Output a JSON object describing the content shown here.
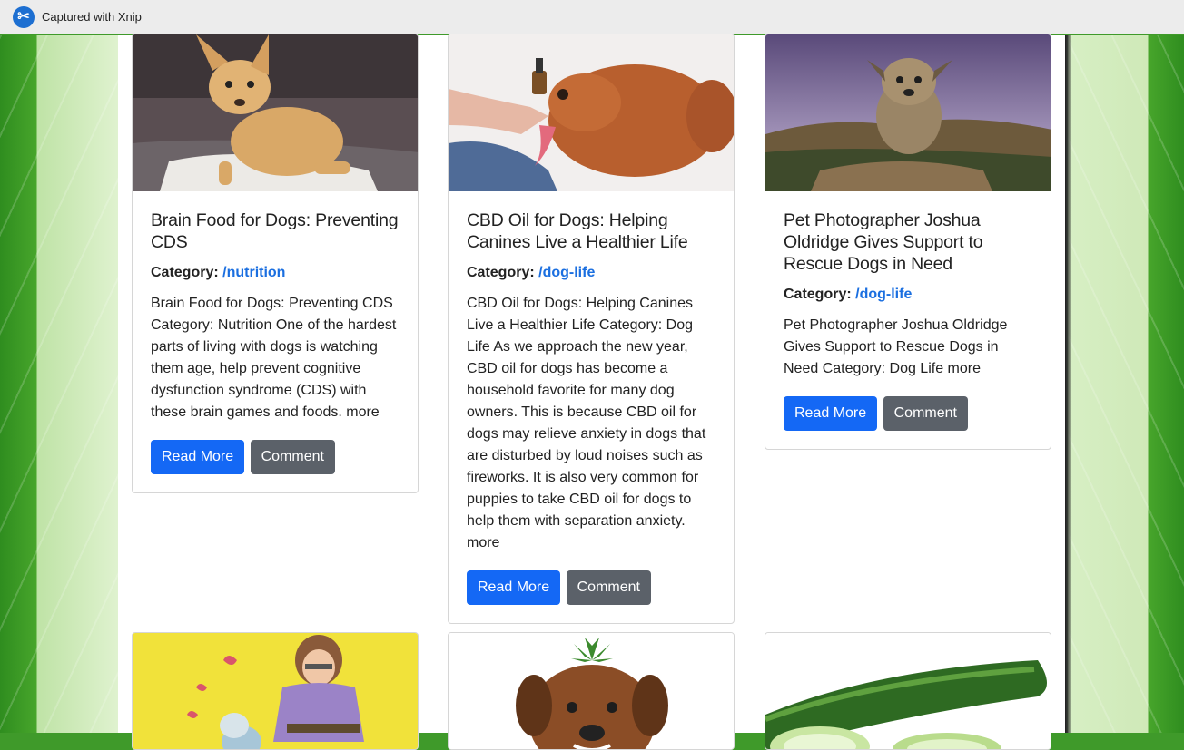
{
  "app": {
    "title": "Captured with Xnip"
  },
  "cards": [
    {
      "title": "Brain Food for Dogs: Preventing CDS",
      "category_label": "Category:",
      "category_link": "/nutrition",
      "excerpt": "Brain Food for Dogs: Preventing CDS Category: Nutrition One of the hardest parts of living with dogs is watching them age, help prevent cognitive dysfunction syndrome (CDS) with these brain games and foods.  more",
      "read_more": "Read More",
      "comment": "Comment",
      "image": "chihuahua-photo"
    },
    {
      "title": "CBD Oil for Dogs: Helping Canines Live a Healthier Life",
      "category_label": "Category:",
      "category_link": "/dog-life",
      "excerpt": "CBD Oil for Dogs: Helping Canines Live a Healthier Life Category: Dog Life As we approach the new year, CBD oil for dogs has become a household favorite for many dog owners. This is because CBD oil for dogs may relieve anxiety in dogs that are disturbed by loud noises such as fireworks. It is also very common for puppies to take CBD oil for dogs to help them with separation anxiety. more",
      "read_more": "Read More",
      "comment": "Comment",
      "image": "poodle-cbd-dropper-photo"
    },
    {
      "title": "Pet Photographer Joshua Oldridge Gives Support to Rescue Dogs in Need",
      "category_label": "Category:",
      "category_link": "/dog-life",
      "excerpt": "Pet Photographer Joshua Oldridge Gives Support to Rescue Dogs in Need Category: Dog Life more",
      "read_more": "Read More",
      "comment": "Comment",
      "image": "dog-on-rock-photo"
    },
    {
      "image": "cartoon-woman-dog-illustration"
    },
    {
      "image": "dog-cannabis-leaf-photo"
    },
    {
      "image": "cucumber-photo"
    }
  ],
  "colors": {
    "link": "#1b6fe0",
    "primary_button": "#1468f5",
    "secondary_button": "#5b6169"
  }
}
